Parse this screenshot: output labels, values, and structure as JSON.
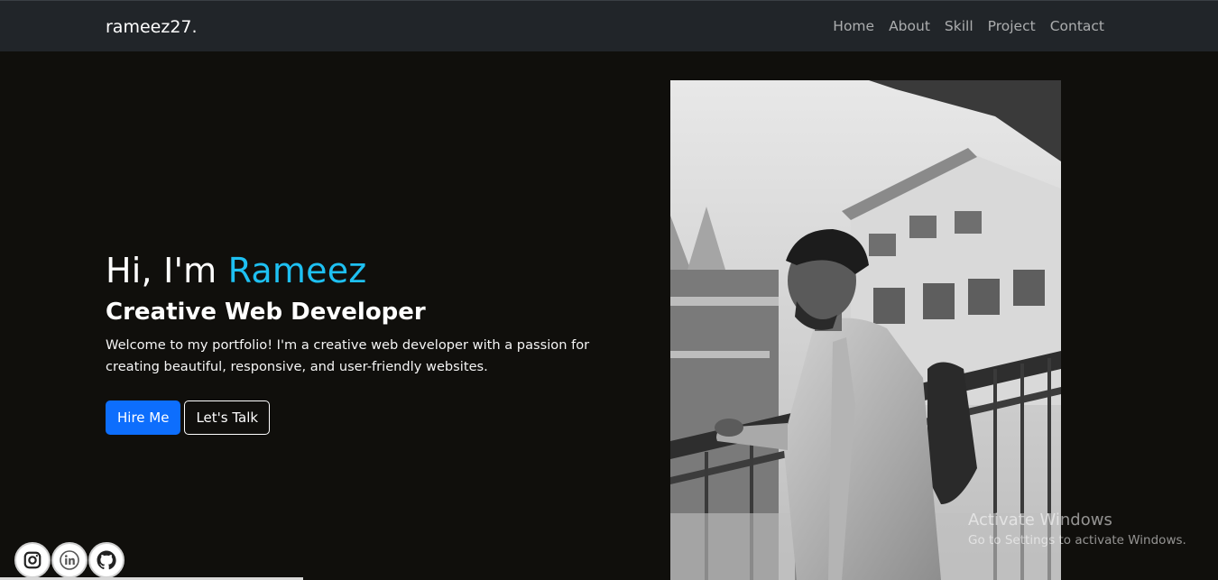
{
  "navbar": {
    "brand": "rameez27.",
    "links": [
      "Home",
      "About",
      "Skill",
      "Project",
      "Contact"
    ]
  },
  "hero": {
    "greeting_prefix": "Hi, I'm ",
    "name": "Rameez",
    "role": "Creative Web Developer",
    "intro": "Welcome to my portfolio! I'm a creative web developer with a passion for creating beautiful, responsive, and user-friendly websites.",
    "primary_button": "Hire Me",
    "secondary_button": "Let's Talk"
  },
  "socials": [
    {
      "icon": "instagram-icon"
    },
    {
      "icon": "linkedin-icon"
    },
    {
      "icon": "github-icon"
    }
  ],
  "watermark": {
    "title": "Activate Windows",
    "subtitle": "Go to Settings to activate Windows."
  },
  "colors": {
    "background": "#100f0c",
    "navbar": "#212529",
    "accent": "#1ec0f2",
    "primary_button": "#0d6efd"
  }
}
